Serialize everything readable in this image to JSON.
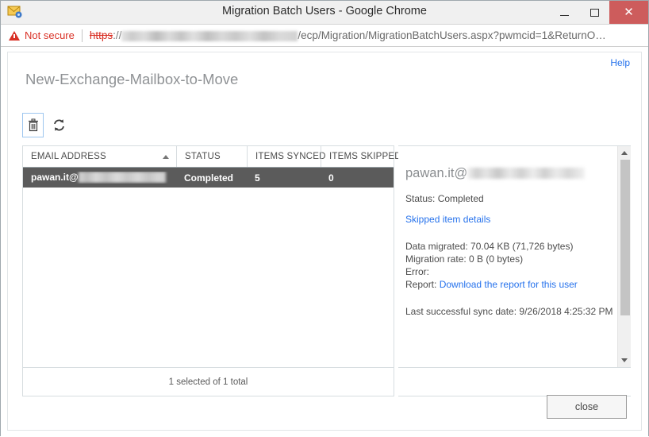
{
  "window": {
    "title": "Migration Batch Users - Google Chrome",
    "favicon": "exchange-envelope-gear-icon",
    "minimize_label": "–",
    "maximize_label": "",
    "close_label": "✕"
  },
  "urlbar": {
    "security_icon": "warning-triangle-icon",
    "security_label": "Not secure",
    "scheme": "https",
    "separator": "://",
    "host_redacted": true,
    "path": "/ecp/Migration/MigrationBatchUsers.aspx?pwmcid=1&ReturnO…"
  },
  "page": {
    "help_label": "Help",
    "title": "New-Exchange-Mailbox-to-Move"
  },
  "toolbar": {
    "buttons": [
      {
        "name": "delete-button",
        "icon": "trash-icon",
        "focused": true
      },
      {
        "name": "refresh-button",
        "icon": "refresh-icon",
        "focused": false
      }
    ]
  },
  "grid": {
    "columns": [
      {
        "label": "EMAIL ADDRESS",
        "sorted": "asc"
      },
      {
        "label": "STATUS",
        "sorted": ""
      },
      {
        "label": "ITEMS SYNCED",
        "sorted": ""
      },
      {
        "label": "ITEMS SKIPPED",
        "sorted": ""
      }
    ],
    "rows": [
      {
        "email_prefix": "pawan.it@",
        "email_domain_redacted": true,
        "status": "Completed",
        "items_synced": "5",
        "items_skipped": "0",
        "selected": true
      }
    ],
    "footer": "1 selected of 1 total"
  },
  "detail": {
    "email_prefix": "pawan.it@",
    "email_domain_redacted": true,
    "status_line": "Status: Completed",
    "skipped_link": "Skipped item details",
    "data_migrated": "Data migrated: 70.04 KB (71,726 bytes)",
    "migration_rate": "Migration rate: 0 B (0 bytes)",
    "error": "Error:",
    "report_label": "Report:",
    "report_link": "Download the report for this user",
    "last_sync": "Last successful sync date: 9/26/2018 4:25:32 PM",
    "scrollbar": {
      "up": "▲",
      "down": "▼"
    }
  },
  "footer": {
    "close_label": "close"
  },
  "colors": {
    "accent_link": "#2672ec",
    "warning": "#d93025",
    "selected_row": "#5b5b5b",
    "title_gray": "#8f9295",
    "close_button_red": "#cd5c5c"
  }
}
